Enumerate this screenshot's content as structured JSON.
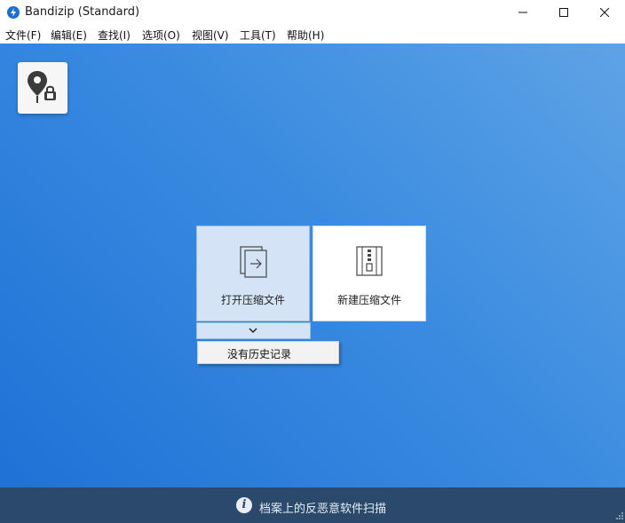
{
  "window": {
    "title": "Bandizip (Standard)"
  },
  "menu": [
    "文件(F)",
    "编辑(E)",
    "查找(I)",
    "选项(O)",
    "视图(V)",
    "工具(T)",
    "帮助(H)"
  ],
  "cards": {
    "open_label": "打开压缩文件",
    "new_label": "新建压缩文件"
  },
  "history": {
    "empty_label": "没有历史记录"
  },
  "status": {
    "text": "档案上的反恶意软件扫描"
  },
  "colors": {
    "accent": "#1f72d6",
    "statusbar": "#2b4a6b",
    "card_selected": "#d4e4f6"
  },
  "icons": [
    "bandizip-app-icon",
    "minimize-icon",
    "maximize-icon",
    "close-icon",
    "map-pin-lock-icon",
    "open-archive-icon",
    "new-archive-icon",
    "chevron-down-icon",
    "info-icon",
    "resize-grip-icon"
  ]
}
